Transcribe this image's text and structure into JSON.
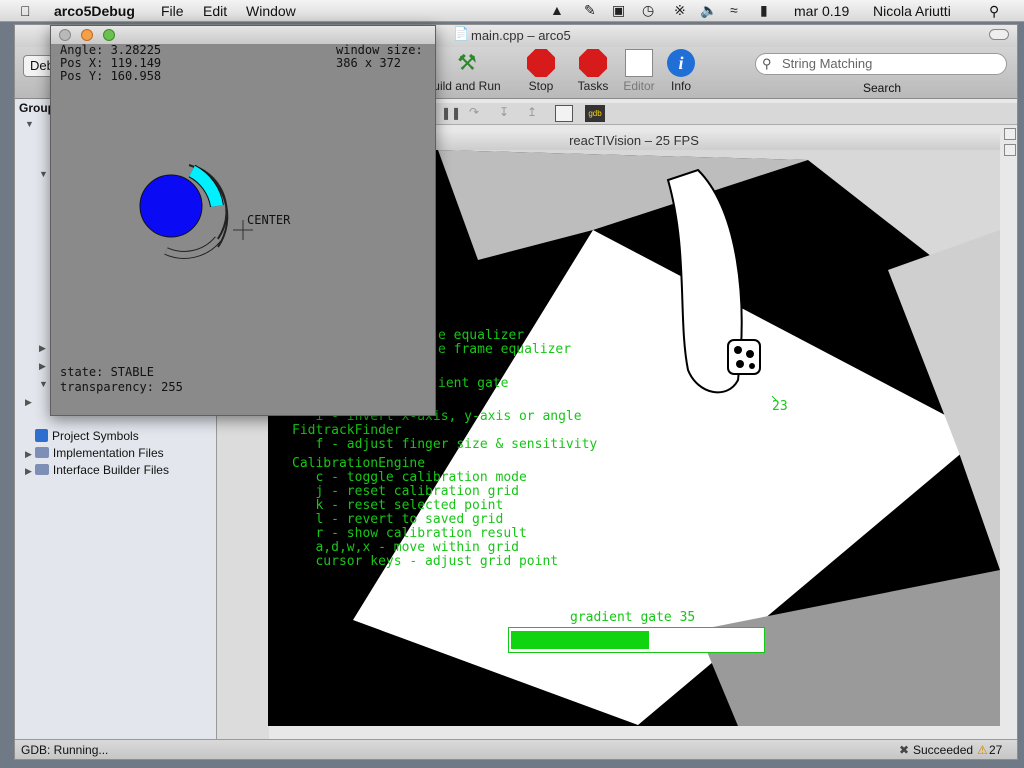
{
  "menubar": {
    "app_name": "arco5Debug",
    "items": [
      "File",
      "Edit",
      "Window"
    ],
    "clock": "mar 0.19",
    "user": "Nicola Ariutti"
  },
  "xcode": {
    "window_title": "main.cpp – arco5",
    "toolbar": {
      "partial_left": "Deb",
      "build_run": "uild and Run",
      "stop": "Stop",
      "tasks": "Tasks",
      "editor": "Editor",
      "info": "Info",
      "search_placeholder": "String Matching",
      "search_label": "Search"
    },
    "sidebar": {
      "header": "Group",
      "items": [
        "Project Symbols",
        "Implementation Files",
        "Interface Builder Files"
      ]
    },
    "status": {
      "left": "GDB: Running...",
      "right": "Succeeded",
      "count": "27"
    }
  },
  "reactivision": {
    "title": "reacTIVision – 25 FPS",
    "help_lines": [
      "e equalizer",
      "e frame equalizer",
      "ient gate",
      "   i - invert x-axis, y-axis or angle",
      "FidtrackFinder",
      "   f - adjust finger size & sensitivity",
      "CalibrationEngine",
      "   c - toggle calibration mode",
      "   j - reset calibration grid",
      "   k - reset selected point",
      "   l - revert to saved grid",
      "   r - show calibration result",
      "   a,d,w,x - move within grid",
      "   cursor keys - adjust grid point"
    ],
    "fiducial_id": "23",
    "gradient_gate_label": "gradient gate 35",
    "gradient_gate_fraction": 0.55
  },
  "debug_window": {
    "angle": "Angle: 3.28225",
    "pos_x": "Pos X: 119.149",
    "pos_y": "Pos Y: 160.958",
    "window_size_label": "window size:",
    "window_size_value": "386 x 372",
    "center_label": "CENTER",
    "state": "state: STABLE",
    "transparency": "transparency: 255"
  }
}
